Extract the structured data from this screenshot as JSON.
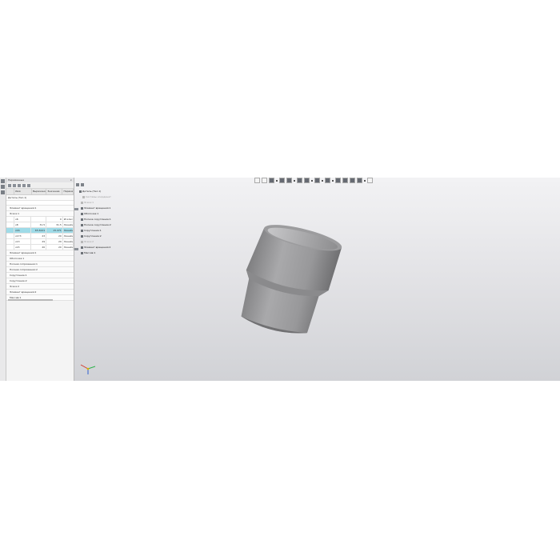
{
  "panel": {
    "title": "Переменные",
    "close": "×",
    "columns": [
      "Имя",
      "Выражение",
      "Значение",
      "Параметр"
    ],
    "top_item": "Деталь (Тел-1)",
    "groups_before": [
      "Эскиз:1"
    ],
    "group_open": "Эскиз:1",
    "rows": [
      {
        "name": "v6",
        "expr": "",
        "value": "0",
        "param": "Исключ"
      },
      {
        "name": "v8",
        "expr": "31.5",
        "value": "31.5",
        "param": "Линейн"
      },
      {
        "name": "v16",
        "expr": "65.6121",
        "value": "15.471",
        "param": "Линейн"
      },
      {
        "name": "v173",
        "expr": "23",
        "value": "20",
        "param": "Линейн"
      },
      {
        "name": "v13",
        "expr": "29",
        "value": "29",
        "param": "Линейн"
      },
      {
        "name": "v15",
        "expr": "20",
        "value": "20",
        "param": "Линейн"
      }
    ],
    "pre_group": "Элемент вращения:1",
    "groups_after": [
      "Элемент вращения:1",
      "Оболочка:1",
      "Полная сопряжения:1",
      "Полная сопряжения:2",
      "Скругление:1",
      "Скругление:2",
      "Эскиз:2",
      "Элемент вращения:2",
      "Массив:1"
    ]
  },
  "tree": {
    "items": [
      {
        "label": "Деталь (Тел-1)",
        "dim": false
      },
      {
        "label": "Системы координат",
        "dim": true
      },
      {
        "label": "Эскиз:1",
        "dim": true
      },
      {
        "label": "Элемент вращения:1",
        "dim": false
      },
      {
        "label": "Оболочка:1",
        "dim": false
      },
      {
        "label": "Полное скругление:1",
        "dim": false
      },
      {
        "label": "Полное скругление:2",
        "dim": false
      },
      {
        "label": "Скругление:1",
        "dim": false
      },
      {
        "label": "Скругление:2",
        "dim": false
      },
      {
        "label": "Эскиз:2",
        "dim": true
      },
      {
        "label": "Элемент вращения:2",
        "dim": false
      },
      {
        "label": "Массив:1",
        "dim": false
      }
    ]
  },
  "colors": {
    "selected_row": "#9fdbe8",
    "axis_x": "#d33a2c",
    "axis_y": "#2db34a",
    "axis_z": "#2f5fd0",
    "model_body": "#9a9a9c"
  }
}
